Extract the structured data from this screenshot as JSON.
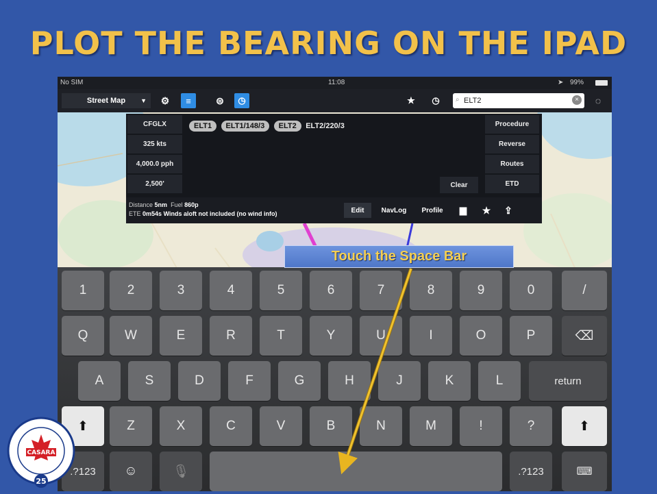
{
  "slide": {
    "title": "PLOT THE BEARING ON THE IPAD"
  },
  "status_bar": {
    "carrier": "No SIM",
    "time": "11:08",
    "battery": "99%"
  },
  "toolbar": {
    "map_type": "Street Map",
    "search_value": "ELT2"
  },
  "panel": {
    "left_buttons": [
      "CFGLX",
      "325 kts",
      "4,000.0 pph",
      "2,500'"
    ],
    "route_chips": [
      "ELT1",
      "ELT1/148/3",
      "ELT2"
    ],
    "route_text": "ELT2/220/3",
    "right_buttons": [
      "Procedure",
      "Reverse",
      "Routes",
      "ETD"
    ],
    "clear_label": "Clear",
    "info": {
      "distance_label": "Distance",
      "distance_value": "5nm",
      "fuel_label": "Fuel",
      "fuel_value": "860p",
      "ete_label": "ETE",
      "ete_value": "0m54s",
      "winds_note": "Winds aloft not included (no wind info)"
    },
    "tabs": [
      "Edit",
      "NavLog",
      "Profile"
    ]
  },
  "keyboard": {
    "row1": [
      "1",
      "2",
      "3",
      "4",
      "5",
      "6",
      "7",
      "8",
      "9",
      "0",
      "/"
    ],
    "row2": [
      "Q",
      "W",
      "E",
      "R",
      "T",
      "Y",
      "U",
      "I",
      "O",
      "P"
    ],
    "row3": [
      "A",
      "S",
      "D",
      "F",
      "G",
      "H",
      "J",
      "K",
      "L"
    ],
    "return_label": "return",
    "row4": [
      "Z",
      "X",
      "C",
      "V",
      "B",
      "N",
      "M",
      "!",
      "?"
    ],
    "numbers_label": ".?123"
  },
  "callout": {
    "text": "Touch the Space Bar"
  },
  "logo": {
    "name": "CASARA",
    "ring_text": "CIVIL AIR SEARCH AND RESCUE",
    "association": "ASSOCIATION",
    "anniversary": "25"
  },
  "colors": {
    "slide_bg": "#3257a8",
    "title": "#f2c14a",
    "callout_text": "#f5cf52",
    "accent_blue": "#2f8de4"
  },
  "icons": [
    "gear-icon",
    "list-icon",
    "layers-icon",
    "compass-icon",
    "stars-icon",
    "clock-icon",
    "search-icon",
    "clear-icon",
    "sync-icon",
    "flight-bag-icon",
    "star-icon",
    "share-icon",
    "shift-icon",
    "delete-icon",
    "emoji-icon",
    "mic-icon",
    "hide-keyboard-icon"
  ]
}
